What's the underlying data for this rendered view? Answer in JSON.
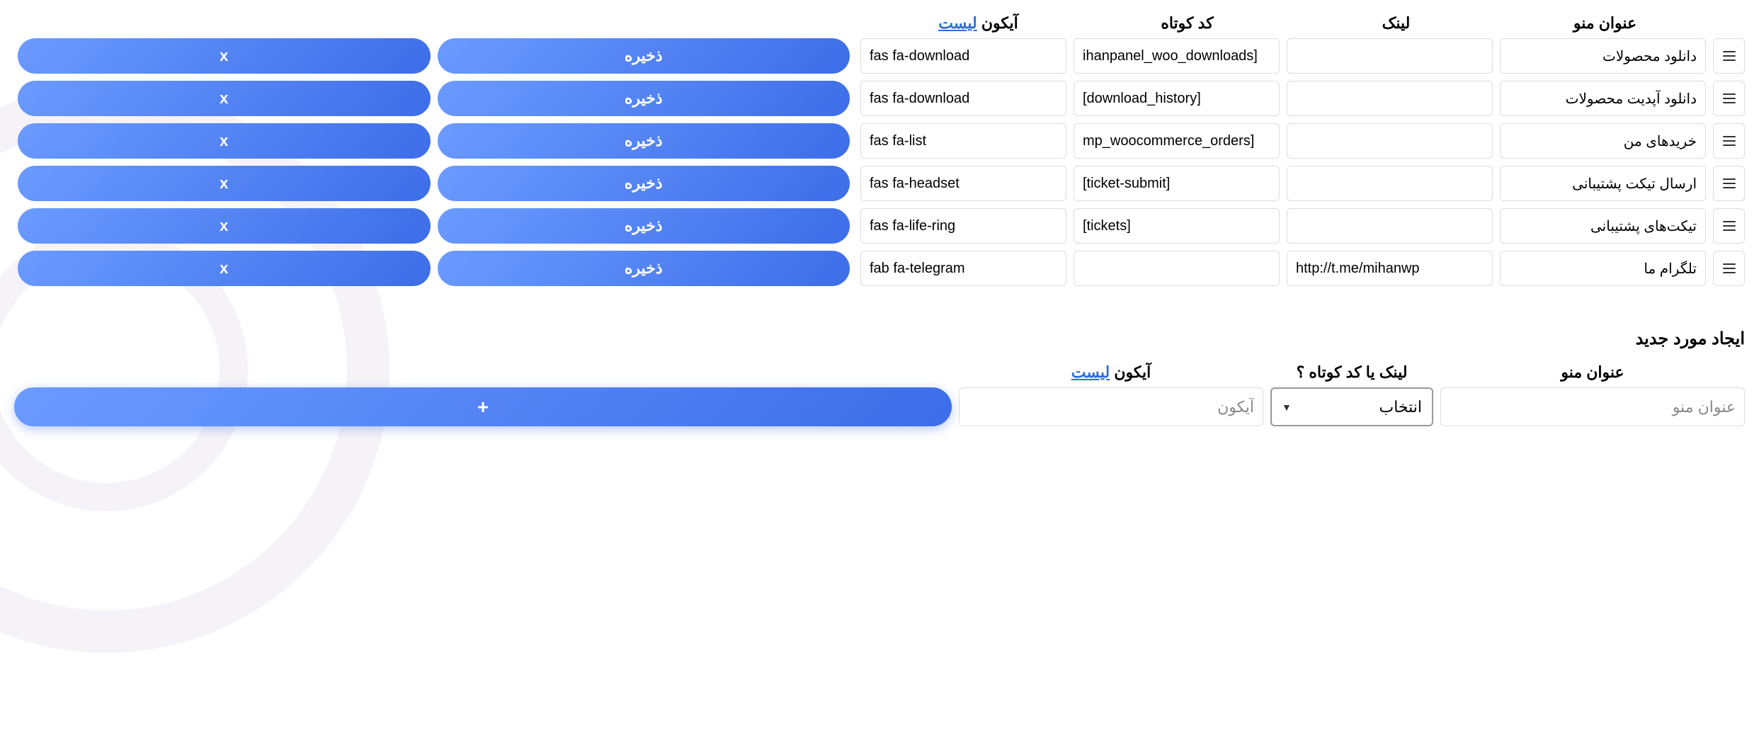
{
  "headers": {
    "menu_title": "عنوان منو",
    "link": "لینک",
    "shortcode": "کد کوتاه",
    "icon_prefix": "آیکون",
    "icon_list_link": "لیست"
  },
  "buttons": {
    "save": "ذخیره",
    "delete": "x",
    "add": "+"
  },
  "rows": [
    {
      "title": "دانلود محصولات",
      "link": "",
      "shortcode": "ihanpanel_woo_downloads]",
      "icon": "fas fa-download"
    },
    {
      "title": "دانلود آپدیت محصولات",
      "link": "",
      "shortcode": "[download_history]",
      "icon": "fas fa-download"
    },
    {
      "title": "خریدهای من",
      "link": "",
      "shortcode": "mp_woocommerce_orders]",
      "icon": "fas fa-list"
    },
    {
      "title": "ارسال تیکت پشتیبانی",
      "link": "",
      "shortcode": "[ticket-submit]",
      "icon": "fas fa-headset"
    },
    {
      "title": "تیکت‌های پشتیبانی",
      "link": "",
      "shortcode": "[tickets]",
      "icon": "fas fa-life-ring"
    },
    {
      "title": "تلگرام ما",
      "link": "http://t.me/mihanwp",
      "shortcode": "",
      "icon": "fab fa-telegram"
    }
  ],
  "new_section": {
    "heading": "ایجاد مورد جدید",
    "headers": {
      "menu_title": "عنوان منو",
      "link_or_short": "لینک یا کد کوتاه ؟",
      "icon_prefix": "آیکون",
      "icon_list_link": "لیست"
    },
    "placeholders": {
      "title": "عنوان منو",
      "icon": "آیکون"
    },
    "select_default": "انتخاب"
  }
}
